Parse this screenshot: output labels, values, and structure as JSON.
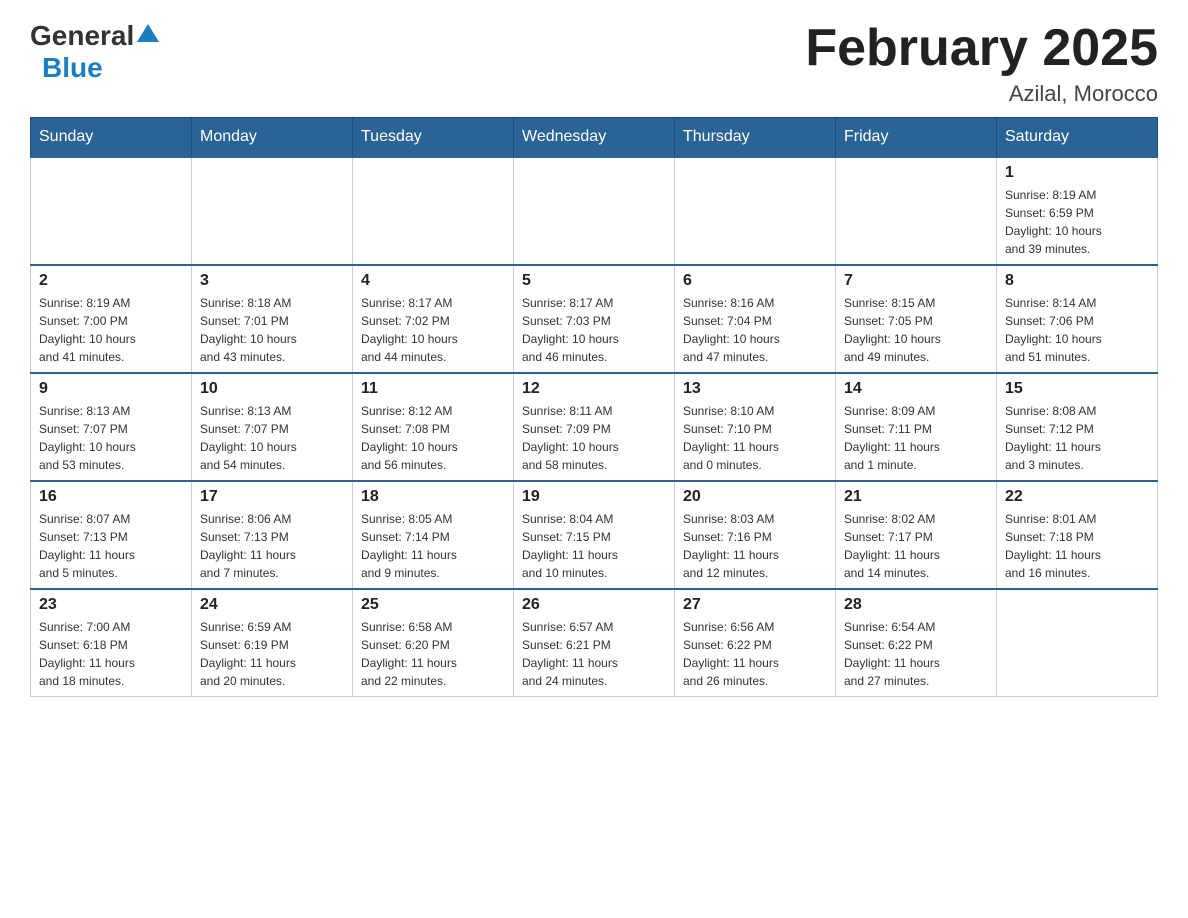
{
  "header": {
    "logo": {
      "general": "General",
      "blue": "Blue"
    },
    "title": "February 2025",
    "location": "Azilal, Morocco"
  },
  "days_of_week": [
    "Sunday",
    "Monday",
    "Tuesday",
    "Wednesday",
    "Thursday",
    "Friday",
    "Saturday"
  ],
  "weeks": [
    [
      {
        "day": "",
        "info": ""
      },
      {
        "day": "",
        "info": ""
      },
      {
        "day": "",
        "info": ""
      },
      {
        "day": "",
        "info": ""
      },
      {
        "day": "",
        "info": ""
      },
      {
        "day": "",
        "info": ""
      },
      {
        "day": "1",
        "info": "Sunrise: 8:19 AM\nSunset: 6:59 PM\nDaylight: 10 hours\nand 39 minutes."
      }
    ],
    [
      {
        "day": "2",
        "info": "Sunrise: 8:19 AM\nSunset: 7:00 PM\nDaylight: 10 hours\nand 41 minutes."
      },
      {
        "day": "3",
        "info": "Sunrise: 8:18 AM\nSunset: 7:01 PM\nDaylight: 10 hours\nand 43 minutes."
      },
      {
        "day": "4",
        "info": "Sunrise: 8:17 AM\nSunset: 7:02 PM\nDaylight: 10 hours\nand 44 minutes."
      },
      {
        "day": "5",
        "info": "Sunrise: 8:17 AM\nSunset: 7:03 PM\nDaylight: 10 hours\nand 46 minutes."
      },
      {
        "day": "6",
        "info": "Sunrise: 8:16 AM\nSunset: 7:04 PM\nDaylight: 10 hours\nand 47 minutes."
      },
      {
        "day": "7",
        "info": "Sunrise: 8:15 AM\nSunset: 7:05 PM\nDaylight: 10 hours\nand 49 minutes."
      },
      {
        "day": "8",
        "info": "Sunrise: 8:14 AM\nSunset: 7:06 PM\nDaylight: 10 hours\nand 51 minutes."
      }
    ],
    [
      {
        "day": "9",
        "info": "Sunrise: 8:13 AM\nSunset: 7:07 PM\nDaylight: 10 hours\nand 53 minutes."
      },
      {
        "day": "10",
        "info": "Sunrise: 8:13 AM\nSunset: 7:07 PM\nDaylight: 10 hours\nand 54 minutes."
      },
      {
        "day": "11",
        "info": "Sunrise: 8:12 AM\nSunset: 7:08 PM\nDaylight: 10 hours\nand 56 minutes."
      },
      {
        "day": "12",
        "info": "Sunrise: 8:11 AM\nSunset: 7:09 PM\nDaylight: 10 hours\nand 58 minutes."
      },
      {
        "day": "13",
        "info": "Sunrise: 8:10 AM\nSunset: 7:10 PM\nDaylight: 11 hours\nand 0 minutes."
      },
      {
        "day": "14",
        "info": "Sunrise: 8:09 AM\nSunset: 7:11 PM\nDaylight: 11 hours\nand 1 minute."
      },
      {
        "day": "15",
        "info": "Sunrise: 8:08 AM\nSunset: 7:12 PM\nDaylight: 11 hours\nand 3 minutes."
      }
    ],
    [
      {
        "day": "16",
        "info": "Sunrise: 8:07 AM\nSunset: 7:13 PM\nDaylight: 11 hours\nand 5 minutes."
      },
      {
        "day": "17",
        "info": "Sunrise: 8:06 AM\nSunset: 7:13 PM\nDaylight: 11 hours\nand 7 minutes."
      },
      {
        "day": "18",
        "info": "Sunrise: 8:05 AM\nSunset: 7:14 PM\nDaylight: 11 hours\nand 9 minutes."
      },
      {
        "day": "19",
        "info": "Sunrise: 8:04 AM\nSunset: 7:15 PM\nDaylight: 11 hours\nand 10 minutes."
      },
      {
        "day": "20",
        "info": "Sunrise: 8:03 AM\nSunset: 7:16 PM\nDaylight: 11 hours\nand 12 minutes."
      },
      {
        "day": "21",
        "info": "Sunrise: 8:02 AM\nSunset: 7:17 PM\nDaylight: 11 hours\nand 14 minutes."
      },
      {
        "day": "22",
        "info": "Sunrise: 8:01 AM\nSunset: 7:18 PM\nDaylight: 11 hours\nand 16 minutes."
      }
    ],
    [
      {
        "day": "23",
        "info": "Sunrise: 7:00 AM\nSunset: 6:18 PM\nDaylight: 11 hours\nand 18 minutes."
      },
      {
        "day": "24",
        "info": "Sunrise: 6:59 AM\nSunset: 6:19 PM\nDaylight: 11 hours\nand 20 minutes."
      },
      {
        "day": "25",
        "info": "Sunrise: 6:58 AM\nSunset: 6:20 PM\nDaylight: 11 hours\nand 22 minutes."
      },
      {
        "day": "26",
        "info": "Sunrise: 6:57 AM\nSunset: 6:21 PM\nDaylight: 11 hours\nand 24 minutes."
      },
      {
        "day": "27",
        "info": "Sunrise: 6:56 AM\nSunset: 6:22 PM\nDaylight: 11 hours\nand 26 minutes."
      },
      {
        "day": "28",
        "info": "Sunrise: 6:54 AM\nSunset: 6:22 PM\nDaylight: 11 hours\nand 27 minutes."
      },
      {
        "day": "",
        "info": ""
      }
    ]
  ]
}
